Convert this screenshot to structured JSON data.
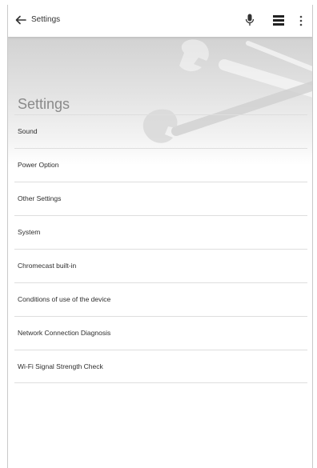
{
  "topbar": {
    "back_icon": "arrow-left-icon",
    "title": "Settings",
    "mic_icon": "microphone-icon",
    "menu_icon": "menu-icon",
    "overflow_icon": "more-vert-icon"
  },
  "header": {
    "title": "Settings",
    "background_art": "wrench-icon"
  },
  "settings": {
    "items": [
      {
        "label": "Sound"
      },
      {
        "label": "Power Option"
      },
      {
        "label": "Other Settings"
      },
      {
        "label": "System"
      },
      {
        "label": "Chromecast built-in"
      },
      {
        "label": "Conditions of use of the device"
      },
      {
        "label": "Network Connection Diagnosis"
      },
      {
        "label": "Wi-Fi Signal Strength Check"
      }
    ]
  },
  "colors": {
    "topbar_bg": "#ffffff",
    "header_gradient_top": "#d2d2d2",
    "text_primary": "#2e2e2e",
    "title_gray": "#8a8a8a",
    "divider": "#dedede"
  }
}
